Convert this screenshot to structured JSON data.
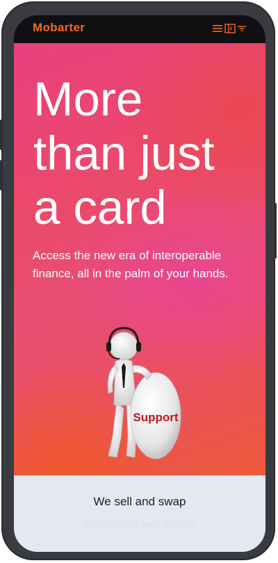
{
  "header": {
    "brand": "Mobarter",
    "icons": [
      "menu-icon",
      "sidebar-icon",
      "filter-icon"
    ]
  },
  "hero": {
    "headline": [
      "More",
      "than just",
      "a card"
    ],
    "subtext": "Access the new era of interoperable finance, all in the palm of your hands.",
    "illustration_label": "Support"
  },
  "bottom": {
    "title": "We sell and swap",
    "subtitle": "Stablecoins and Bitcoin"
  },
  "colors": {
    "brand": "#f26a1f",
    "hero_pink": "#e9407e",
    "hero_orange": "#ee5a3a",
    "bottom_bg": "#e4e9f1"
  }
}
